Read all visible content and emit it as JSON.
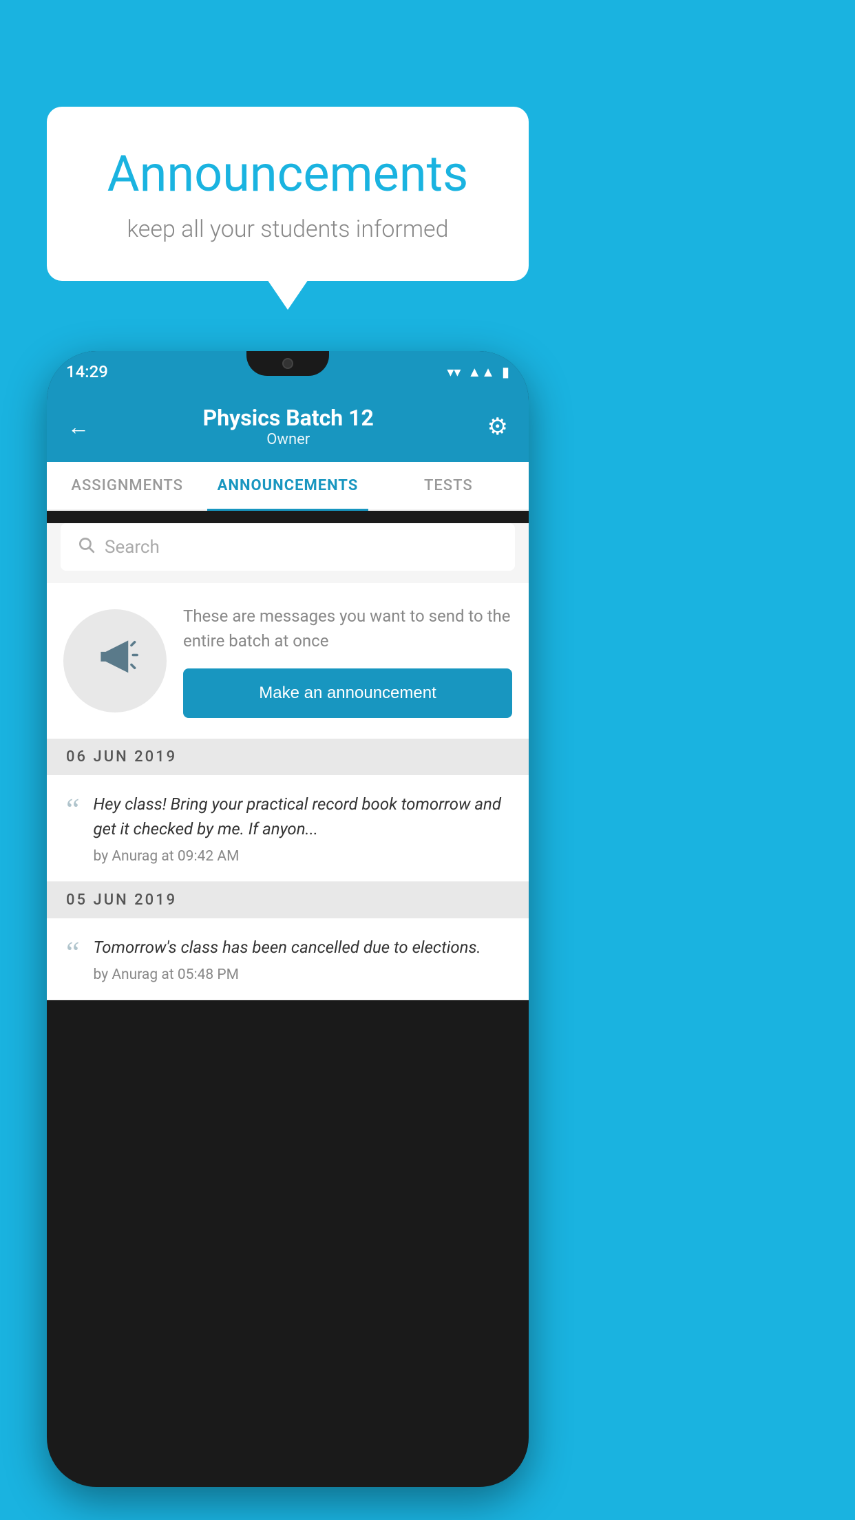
{
  "background_color": "#1ab3e0",
  "speech_bubble": {
    "title": "Announcements",
    "subtitle": "keep all your students informed"
  },
  "phone": {
    "status_bar": {
      "time": "14:29",
      "icons": [
        "wifi",
        "signal",
        "battery"
      ]
    },
    "header": {
      "title": "Physics Batch 12",
      "subtitle": "Owner",
      "back_label": "←",
      "gear_label": "⚙"
    },
    "tabs": [
      {
        "label": "ASSIGNMENTS",
        "active": false
      },
      {
        "label": "ANNOUNCEMENTS",
        "active": true
      },
      {
        "label": "TESTS",
        "active": false
      }
    ],
    "search": {
      "placeholder": "Search"
    },
    "announcement_promo": {
      "description": "These are messages you want to send to the entire batch at once",
      "button_label": "Make an announcement"
    },
    "announcements": [
      {
        "date": "06  JUN  2019",
        "messages": [
          {
            "text": "Hey class! Bring your practical record book tomorrow and get it checked by me. If anyon...",
            "author": "by Anurag at 09:42 AM"
          }
        ]
      },
      {
        "date": "05  JUN  2019",
        "messages": [
          {
            "text": "Tomorrow's class has been cancelled due to elections.",
            "author": "by Anurag at 05:48 PM"
          }
        ]
      }
    ]
  }
}
